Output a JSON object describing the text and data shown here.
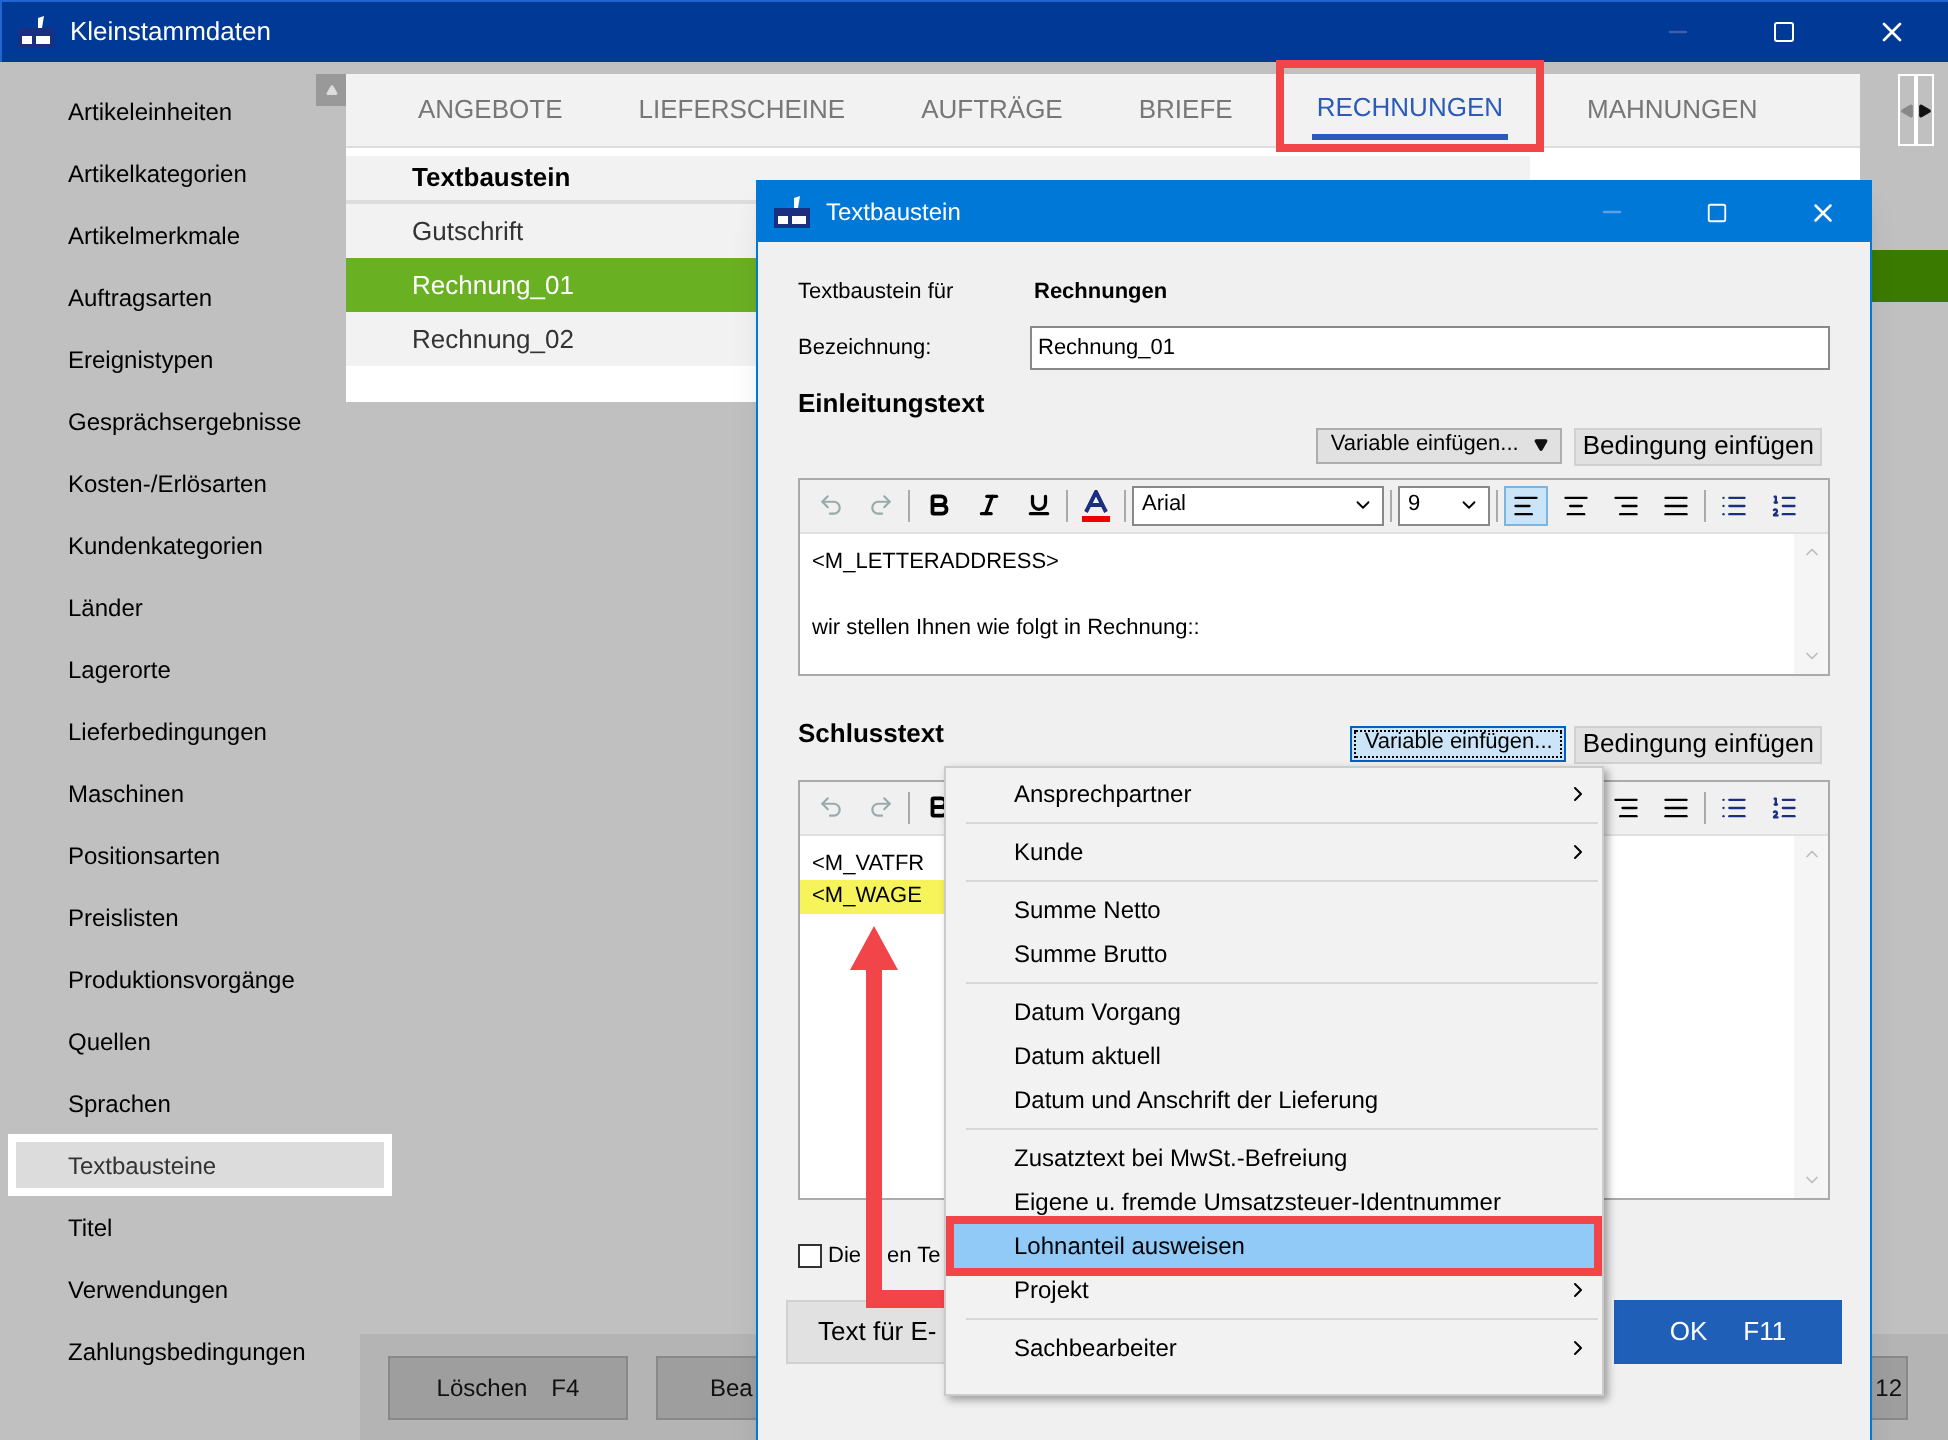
{
  "window": {
    "title": "Kleinstammdaten"
  },
  "sidebar": {
    "items": [
      {
        "label": "Artikeleinheiten",
        "selected": false
      },
      {
        "label": "Artikelkategorien",
        "selected": false
      },
      {
        "label": "Artikelmerkmale",
        "selected": false
      },
      {
        "label": "Auftragsarten",
        "selected": false
      },
      {
        "label": "Ereignistypen",
        "selected": false
      },
      {
        "label": "Gesprächsergebnisse",
        "selected": false
      },
      {
        "label": "Kosten-/Erlösarten",
        "selected": false
      },
      {
        "label": "Kundenkategorien",
        "selected": false
      },
      {
        "label": "Länder",
        "selected": false
      },
      {
        "label": "Lagerorte",
        "selected": false
      },
      {
        "label": "Lieferbedingungen",
        "selected": false
      },
      {
        "label": "Maschinen",
        "selected": false
      },
      {
        "label": "Positionsarten",
        "selected": false
      },
      {
        "label": "Preislisten",
        "selected": false
      },
      {
        "label": "Produktionsvorgänge",
        "selected": false
      },
      {
        "label": "Quellen",
        "selected": false
      },
      {
        "label": "Sprachen",
        "selected": false
      },
      {
        "label": "Textbausteine",
        "selected": true
      },
      {
        "label": "Titel",
        "selected": false
      },
      {
        "label": "Verwendungen",
        "selected": false
      },
      {
        "label": "Zahlungsbedingungen",
        "selected": false
      }
    ]
  },
  "tabs": [
    {
      "label": "ANGEBOTE",
      "selected": false
    },
    {
      "label": "LIEFERSCHEINE",
      "selected": false
    },
    {
      "label": "AUFTRÄGE",
      "selected": false
    },
    {
      "label": "BRIEFE",
      "selected": false
    },
    {
      "label": "RECHNUNGEN",
      "selected": true
    },
    {
      "label": "MAHNUNGEN",
      "selected": false
    }
  ],
  "list": {
    "header": "Textbaustein",
    "rows": [
      {
        "label": "Gutschrift",
        "selected": false
      },
      {
        "label": "Rechnung_01",
        "selected": true
      },
      {
        "label": "Rechnung_02",
        "selected": false
      }
    ]
  },
  "main_buttons": [
    {
      "label": "Löschen",
      "key": "F4"
    },
    {
      "label": "Bea"
    },
    {
      "key": "12"
    }
  ],
  "dialog": {
    "title": "Textbaustein",
    "for_label": "Textbaustein für",
    "for_value": "Rechnungen",
    "name_label": "Bezeichnung:",
    "name_value": "Rechnung_01",
    "intro_heading": "Einleitungstext",
    "closing_heading": "Schlusstext",
    "variable_button": "Variable einfügen...",
    "variable_button_2": "Variable einfügen...",
    "condition_button": "Bedingung einfügen",
    "condition_button_2": "Bedingung einfügen",
    "font": "Arial",
    "size": "9",
    "alignment_buttons": [
      {
        "kind": "left",
        "selected": true
      },
      {
        "kind": "center",
        "selected": false
      },
      {
        "kind": "right",
        "selected": false
      },
      {
        "kind": "justify",
        "selected": false
      }
    ],
    "intro_lines": [
      "<M_LETTERADDRESS>",
      "wir  stellen Ihnen wie  folgt in Rechnung::"
    ],
    "closing_lines": [
      {
        "text": "<M_VATFR",
        "highlighted": false
      },
      {
        "text": "<M_WAGE",
        "highlighted": true
      }
    ],
    "checkbox": {
      "label": "Die",
      "label_2": "en Te",
      "checked": false
    },
    "email_button": "Text für E-",
    "ok_button": {
      "label": "OK",
      "key": "F11"
    }
  },
  "menu": {
    "items": [
      {
        "kind": "item",
        "label": "Ansprechpartner",
        "submenu": true,
        "selected": false
      },
      {
        "kind": "separator"
      },
      {
        "kind": "item",
        "label": "Kunde",
        "submenu": true,
        "selected": false
      },
      {
        "kind": "separator"
      },
      {
        "kind": "item",
        "label": "Summe Netto",
        "submenu": false,
        "selected": false
      },
      {
        "kind": "item",
        "label": "Summe Brutto",
        "submenu": false,
        "selected": false
      },
      {
        "kind": "separator"
      },
      {
        "kind": "item",
        "label": "Datum Vorgang",
        "submenu": false,
        "selected": false
      },
      {
        "kind": "item",
        "label": "Datum aktuell",
        "submenu": false,
        "selected": false
      },
      {
        "kind": "item",
        "label": "Datum und Anschrift der Lieferung",
        "submenu": false,
        "selected": false
      },
      {
        "kind": "separator"
      },
      {
        "kind": "item",
        "label": "Zusatztext bei MwSt.-Befreiung",
        "submenu": false,
        "selected": false
      },
      {
        "kind": "item",
        "label": "Eigene u. fremde Umsatzsteuer-Identnummer",
        "submenu": false,
        "selected": false
      },
      {
        "kind": "item",
        "label": "Lohnanteil ausweisen",
        "submenu": false,
        "selected": true
      },
      {
        "kind": "item",
        "label": "Projekt",
        "submenu": true,
        "selected": false
      },
      {
        "kind": "separator"
      },
      {
        "kind": "item",
        "label": "Sachbearbeiter",
        "submenu": true,
        "selected": false
      }
    ]
  }
}
